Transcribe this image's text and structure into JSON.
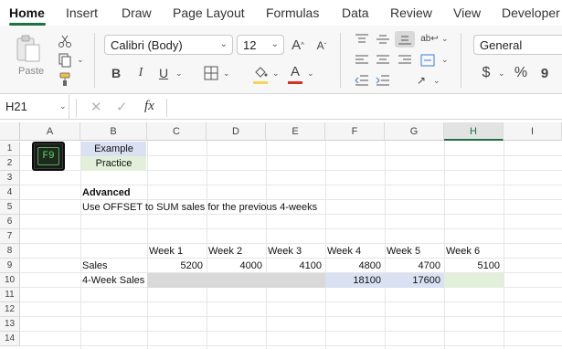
{
  "ribbon_tabs": [
    "Home",
    "Insert",
    "Draw",
    "Page Layout",
    "Formulas",
    "Data",
    "Review",
    "View",
    "Developer"
  ],
  "active_tab": "Home",
  "clipboard": {
    "paste_label": "Paste"
  },
  "font": {
    "name": "Calibri (Body)",
    "size": "12",
    "bold": "B",
    "italic": "I",
    "underline": "U",
    "grow": "A",
    "shrink": "A",
    "color": "A"
  },
  "number": {
    "format": "General",
    "currency": "$",
    "percent": "%",
    "comma": "9"
  },
  "formula_bar": {
    "name_box": "H21",
    "fx": "fx",
    "cancel": "✕",
    "enter": "✓",
    "formula": ""
  },
  "columns": [
    "A",
    "B",
    "C",
    "D",
    "E",
    "F",
    "G",
    "H",
    "I"
  ],
  "selected_column": "H",
  "rows": [
    "1",
    "2",
    "3",
    "4",
    "5",
    "6",
    "7",
    "8",
    "9",
    "10",
    "11",
    "12",
    "13",
    "14"
  ],
  "key_badge": "F9",
  "sheet": {
    "example_label": "Example",
    "practice_label": "Practice",
    "heading": "Advanced",
    "instruction": "Use OFFSET to SUM sales for the previous 4-weeks",
    "week_headers": [
      "Week 1",
      "Week 2",
      "Week 3",
      "Week 4",
      "Week 5",
      "Week 6"
    ],
    "sales_label": "Sales",
    "sales_values": [
      "5200",
      "4000",
      "4100",
      "4800",
      "4700",
      "5100"
    ],
    "rolling_label": "4-Week Sales",
    "rolling_values": [
      "",
      "",
      "",
      "18100",
      "17600",
      ""
    ]
  },
  "colors": {
    "accent": "#1e7145",
    "example_fill": "#d9e1f2",
    "practice_fill": "#e2efda",
    "gray_fill": "#d9d9d9"
  }
}
